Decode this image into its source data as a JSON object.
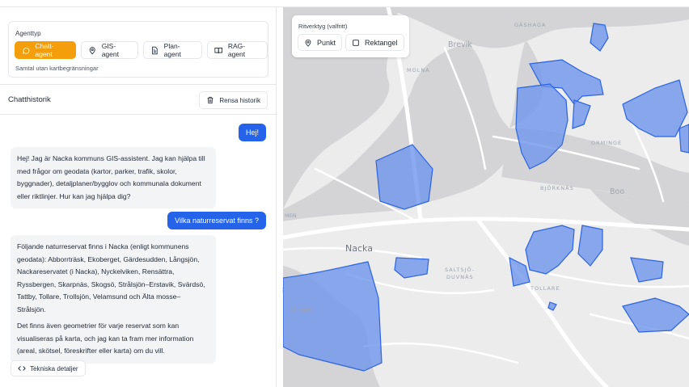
{
  "agent": {
    "title": "Agenttyp",
    "buttons": [
      {
        "label": "Chatt-agent",
        "icon": "chat-bubble-icon"
      },
      {
        "label": "GIS-agent",
        "icon": "map-pin-icon"
      },
      {
        "label": "Plan-agent",
        "icon": "document-icon"
      },
      {
        "label": "RAG-agent",
        "icon": "book-icon"
      }
    ],
    "description": "Samtal utan kartbegränsningar"
  },
  "history": {
    "title": "Chatthistorik",
    "clear_label": "Rensa historik"
  },
  "messages": [
    {
      "role": "user",
      "text": "Hej!"
    },
    {
      "role": "assistant",
      "paragraphs": [
        "Hej! Jag är Nacka kommuns GIS-assistent. Jag kan hjälpa till med frågor om geodata (kartor, parker, trafik, skolor, byggnader), detaljplaner/bygglov och kommunala dokument eller riktlinjer. Hur kan jag hjälpa dig?"
      ]
    },
    {
      "role": "user",
      "text": "Vilka naturreservat finns ?"
    },
    {
      "role": "assistant",
      "paragraphs": [
        "Följande naturreservat finns i Nacka (enligt kommunens geodata): Abborrträsk, Ekoberget, Gärdesudden, Långsjön, Nackareservatet (i Nacka), Nyckelviken, Rensättra, Ryssbergen, Skarpnäs, Skogsö, Strålsjön–Erstavik, Svärdsö, Tattby, Tollare, Trollsjön, Velamsund och Älta mosse–Strålsjön.",
        "Det finns även geometrier för varje reservat som kan visualiseras på karta, och jag kan ta fram mer information (areal, skötsel, föreskrifter eller karta) om du vill."
      ]
    }
  ],
  "tech_details_label": "Tekniska detaljer",
  "draw": {
    "title": "Ritverktyg (valfritt)",
    "point_label": "Punkt",
    "rect_label": "Rektangel"
  },
  "map": {
    "labels": {
      "gashaga": "GÄSHAGA",
      "brevik": "Brevik",
      "molna": "MOLNA",
      "orminge": "ORMINGE",
      "bjorknas": "BJÖRKNÄS",
      "boo": "Boo",
      "nacka": "Nacka",
      "saltsjo": "SALTSJÖ-",
      "duvnas": "DUVNÄS",
      "tollare": "TOLLARE",
      "sthagen": "sthagen",
      "men": "MEN"
    },
    "reserve_color": "#6f95ec",
    "reserve_stroke": "#2b63e0"
  }
}
